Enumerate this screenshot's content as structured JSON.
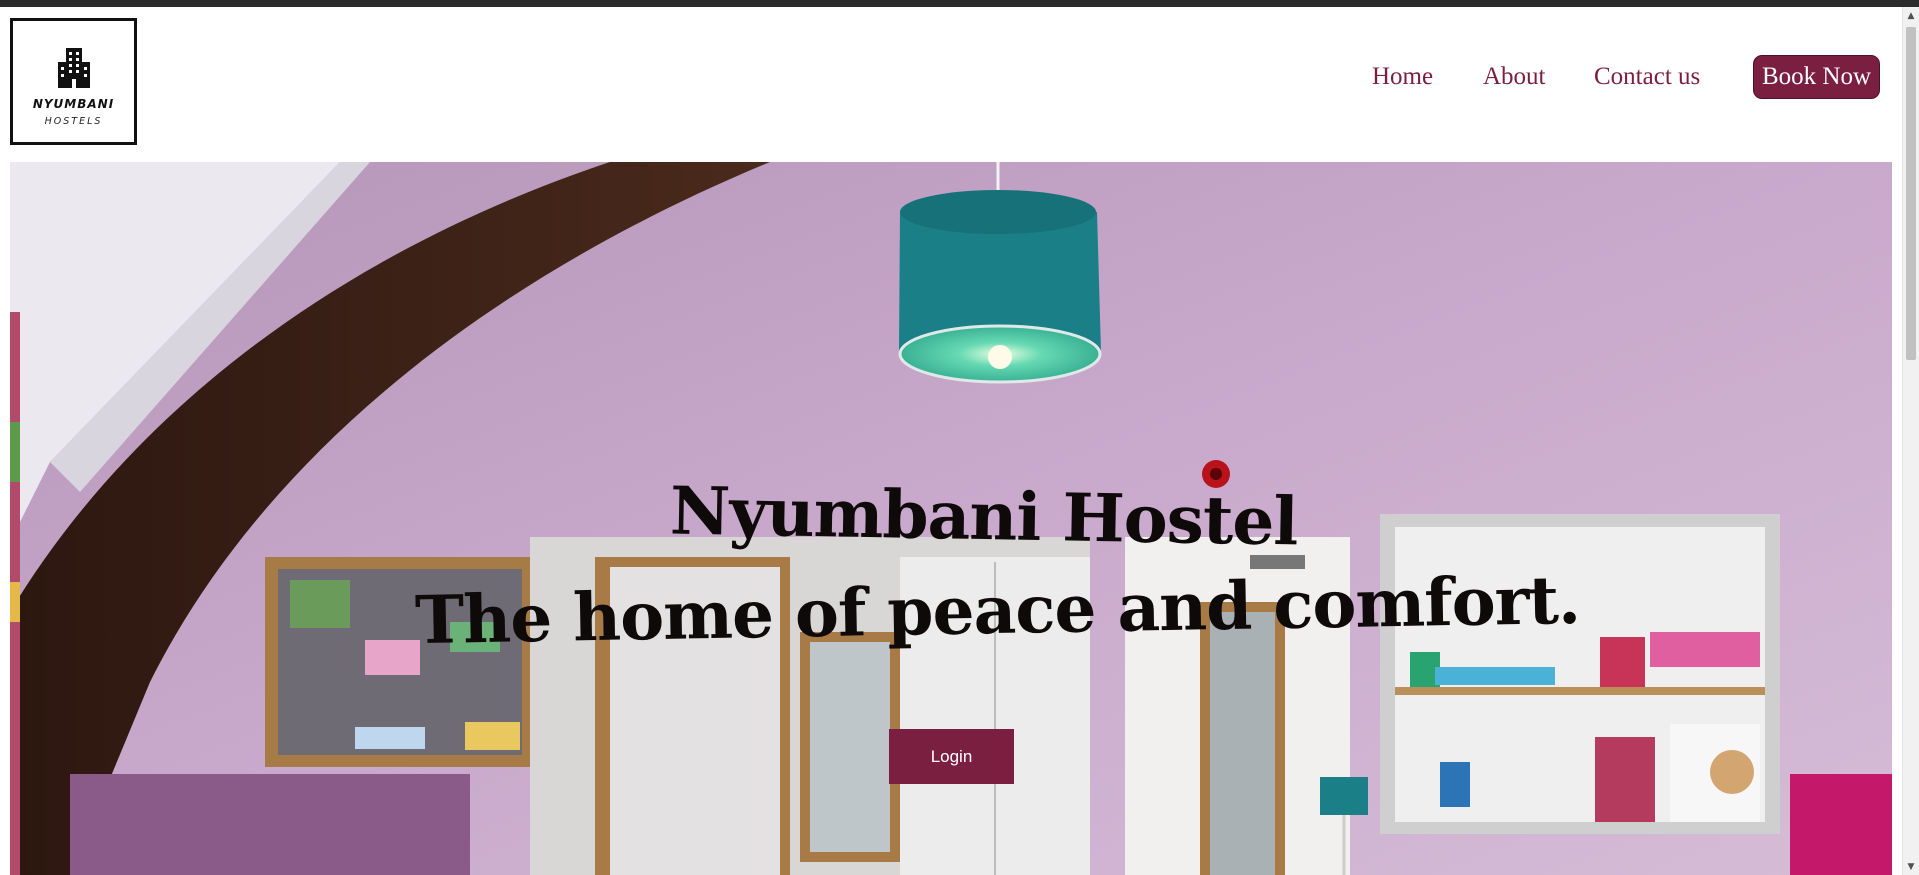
{
  "brand": {
    "name": "NYUMBANI",
    "sub": "HOSTELS",
    "logo_icon": "building-icon"
  },
  "nav": {
    "home": "Home",
    "about": "About",
    "contact": "Contact us",
    "book": "Book Now"
  },
  "hero": {
    "title": "Nyumbani Hostel",
    "subtitle": "The home of peace and comfort.",
    "login": "Login"
  },
  "colors": {
    "accent": "#7b1f40",
    "wall": "#c6a4c8",
    "lamp": "#1a7f86"
  }
}
